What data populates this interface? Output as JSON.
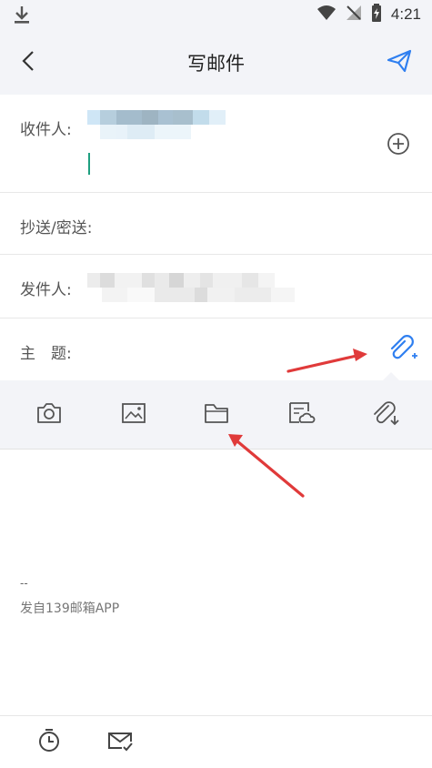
{
  "status_bar": {
    "download_icon": "download-icon",
    "wifi_icon": "wifi-icon",
    "signal_icon": "no-signal-icon",
    "battery_icon": "battery-charging-icon",
    "time": "4:21"
  },
  "header": {
    "back_icon": "chevron-left-icon",
    "title": "写邮件",
    "send_icon": "paper-plane-icon"
  },
  "compose": {
    "to_label": "收件人:",
    "add_recipient_icon": "plus-circle-icon",
    "cc_bcc_label": "抄送/密送:",
    "from_label": "发件人:",
    "subject_label": "主　题:",
    "attach_icon": "paperclip-plus-icon"
  },
  "toolbar": {
    "items": [
      {
        "name": "camera",
        "icon": "camera-icon"
      },
      {
        "name": "image",
        "icon": "image-icon"
      },
      {
        "name": "folder",
        "icon": "folder-icon"
      },
      {
        "name": "cloud-doc",
        "icon": "cloud-document-icon"
      },
      {
        "name": "attachment-download",
        "icon": "paperclip-download-icon"
      }
    ]
  },
  "body": {
    "signature_dash": "--",
    "signature": "发自139邮箱APP"
  },
  "bottom_bar": {
    "timer_icon": "timer-icon",
    "mail_check_icon": "mail-check-icon"
  },
  "colors": {
    "accent": "#2f7ff0",
    "bar_bg": "#f3f4f8",
    "caret": "#1e9f80",
    "annotation_arrow": "#e03a3a"
  }
}
